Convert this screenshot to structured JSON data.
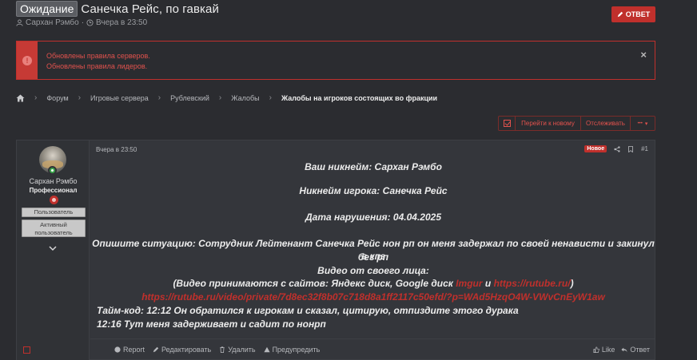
{
  "header": {
    "status_label": "Ожидание",
    "title": "Санечка Рейс, по гавкай",
    "author": "Сархан Рэмбо",
    "date": "Вчера в 23:50",
    "reply_label": "ОТВЕТ"
  },
  "notice": {
    "lines": [
      "Обновлены правила серверов.",
      "Обновлены правила лидеров."
    ],
    "close": "×"
  },
  "breadcrumb": {
    "items": [
      "Форум",
      "Игровые сервера",
      "Рублевский",
      "Жалобы",
      "Жалобы на игроков состоящих во фракции"
    ]
  },
  "actions": {
    "go_new": "Перейти к новому",
    "follow": "Отслеживать",
    "more": "•••"
  },
  "post": {
    "date": "Вчера в 23:50",
    "new_badge": "Новое",
    "number": "#1",
    "user": {
      "name": "Сархан Рэмбо",
      "rank": "Профессионал",
      "tags": [
        "Пользователь",
        "Активный пользователь"
      ]
    },
    "lines": {
      "l1": "Ваш никнейм: Сархан Рэмбо",
      "l2": "Никнейм игрока: Санечка Рейс",
      "l3": "Дата нарушения: 04.04.2025",
      "l4a": "Опишите ситуацию: Сотрудник Лейтенант Санечка Рейс нон рп он меня задержал по своей ненависти и закинул в кпз",
      "l4b": "без рп",
      "l5": "Видео от своего лица:",
      "l6_prefix": "(Видео принимаются с сайтов: Яндекс диск, Google диск ",
      "l6_link1": "Imgur",
      "l6_mid": " и ",
      "l6_link2": "https://rutube.ru/",
      "l6_suffix": ")",
      "l7_link": "https://rutube.ru/video/private/7d8ec32f8b07c718d8a1ff2117c50efd/?p=WAd5HzqO4W-VWvCnEyW1aw",
      "l8": "Тайм-код: 12:12 Он обратился к игрокам и сказал, цитирую, отпиздите этого дурака",
      "l9": "12:16 Тут меня задерживает и садит по нонрп"
    },
    "footer": {
      "report": "Report",
      "edit": "Редактировать",
      "delete": "Удалить",
      "warn": "Предупредить",
      "like": "Like",
      "reply": "Ответ"
    }
  },
  "colors": {
    "accent": "#c0302c",
    "background": "#2b2c30",
    "post_bg": "#34363b"
  }
}
